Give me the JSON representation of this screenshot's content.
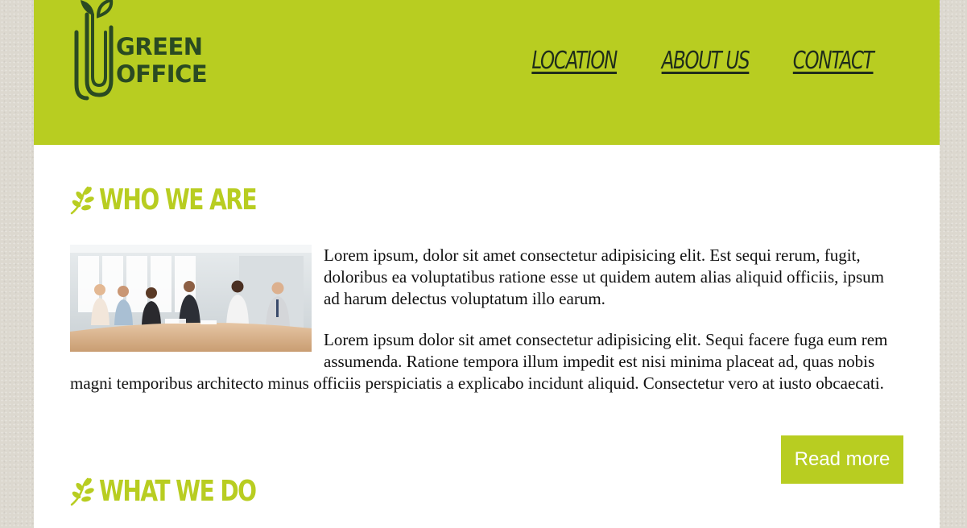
{
  "header": {
    "logo": {
      "line1": "GREEN",
      "line2": "OFFICE"
    },
    "nav": [
      "LOCATION",
      "ABOUT US",
      "CONTACT"
    ]
  },
  "sections": [
    {
      "title": "WHO WE ARE"
    },
    {
      "title": "WHAT WE DO"
    }
  ],
  "about": {
    "photo_alt": "team-meeting-photo",
    "paragraph1": "Lorem ipsum, dolor sit amet consectetur adipisicing elit. Est sequi rerum, fugit, doloribus ea voluptatibus ratione esse ut quidem autem alias aliquid officiis, ipsum ad harum delectus voluptatum illo earum.",
    "paragraph2": "Lorem ipsum dolor sit amet consectetur adipisicing elit. Sequi facere fuga eum rem assumenda. Ratione tempora illum impedit est nisi minima placeat ad, quas nobis magni temporibus architecto minus officiis perspiciatis a explicabo incidunt aliquid. Consectetur vero at iusto obcaecati.",
    "read_more": "Read more"
  },
  "colors": {
    "brand_green": "#b8cd21",
    "logo_dark_green": "#2a4a22",
    "nav_text": "#1f2d1a",
    "background": "#dcd8cf"
  }
}
